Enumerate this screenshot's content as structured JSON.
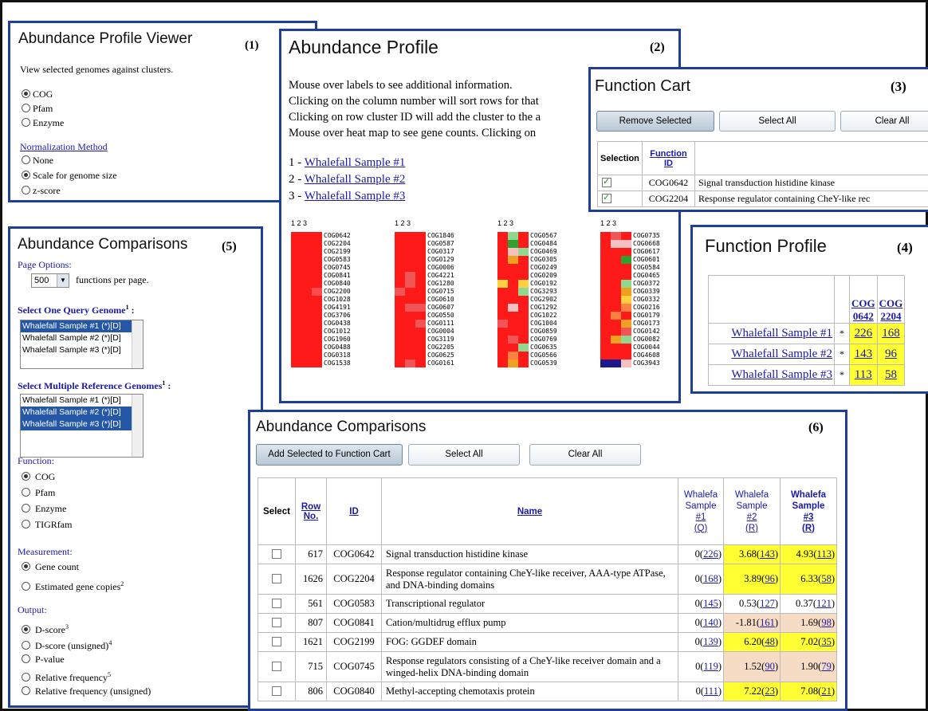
{
  "p1": {
    "title": "Abundance Profile Viewer",
    "num": "(1)",
    "desc": "View selected genomes against clusters.",
    "func_options": [
      {
        "label": "COG",
        "on": true
      },
      {
        "label": "Pfam",
        "on": false
      },
      {
        "label": "Enzyme",
        "on": false
      }
    ],
    "norm_label": "Normalization Method",
    "norm_options": [
      {
        "label": "None",
        "on": false
      },
      {
        "label": "Scale for genome size",
        "on": true
      },
      {
        "label": "z-score",
        "on": false
      }
    ]
  },
  "p2": {
    "title": "Abundance Profile",
    "num": "(2)",
    "lines": [
      "Mouse over labels to see additional information.",
      "Clicking on the column number will sort rows for that",
      "Clicking on row cluster ID will add the cluster to the a",
      "Mouse over heat map to see gene counts. Clicking on"
    ],
    "samples": [
      {
        "prefix": "1 - ",
        "name": "Whalefall Sample #1"
      },
      {
        "prefix": "2 - ",
        "name": "Whalefall Sample #2"
      },
      {
        "prefix": "3 - ",
        "name": "Whalefall Sample #3"
      }
    ],
    "heatmap_header": "1 2 3",
    "heatmap_cols": [
      {
        "ids": [
          "COG0642",
          "COG2204",
          "COG2199",
          "COG0583",
          "COG0745",
          "COG0841",
          "COG0840",
          "COG2200",
          "COG1028",
          "COG4191",
          "COG3706",
          "COG0438",
          "COG1012",
          "COG1960",
          "COG0488",
          "COG0318",
          "COG1538"
        ]
      },
      {
        "ids": [
          "COG1846",
          "COG0587",
          "COG0317",
          "COG0129",
          "COG0006",
          "COG4221",
          "COG1280",
          "COG0715",
          "COG0610",
          "COG0607",
          "COG0550",
          "COG0111",
          "COG0004",
          "COG3119",
          "COG2205",
          "COG0625",
          "COG0161"
        ]
      },
      {
        "ids": [
          "COG0567",
          "COG0484",
          "COG0469",
          "COG0305",
          "COG0249",
          "COG0209",
          "COG0192",
          "COG3293",
          "COG2902",
          "COG1292",
          "COG1022",
          "COG1004",
          "COG0859",
          "COG0769",
          "COG0635",
          "COG0566",
          "COG0539"
        ]
      },
      {
        "ids": [
          "COG0735",
          "COG0668",
          "COG0617",
          "COG0601",
          "COG0584",
          "COG0465",
          "COG0372",
          "COG0339",
          "COG0332",
          "COG0216",
          "COG0179",
          "COG0173",
          "COG0142",
          "COG0082",
          "COG0044",
          "COG4608",
          "COG3943"
        ]
      }
    ]
  },
  "p3": {
    "title": "Function Cart",
    "num": "(3)",
    "btn_remove": "Remove Selected",
    "btn_select_all": "Select All",
    "btn_clear_all": "Clear All",
    "col_selection": "Selection",
    "col_function_id": "Function ID",
    "rows": [
      {
        "id": "COG0642",
        "name": "Signal transduction histidine kinase"
      },
      {
        "id": "COG2204",
        "name": "Response regulator containing CheY-like rec"
      }
    ]
  },
  "p4": {
    "title": "Function Profile",
    "num": "(4)",
    "cols": [
      {
        "a": "COG",
        "b": "0642"
      },
      {
        "a": "COG",
        "b": "2204"
      }
    ],
    "rows": [
      {
        "name": "Whalefall Sample #1",
        "star": "*",
        "v1": "226",
        "v2": "168"
      },
      {
        "name": "Whalefall Sample #2",
        "star": "*",
        "v1": "143",
        "v2": "96"
      },
      {
        "name": "Whalefall Sample #3",
        "star": "*",
        "v1": "113",
        "v2": "58"
      }
    ]
  },
  "p5": {
    "title": "Abundance Comparisons",
    "num": "(5)",
    "page_options": "Page Options",
    "per_page_value": "500",
    "per_page_label": "functions per page.",
    "query_label": "Select One Query Genome",
    "query_sup": "1",
    "query_options": [
      {
        "label": "Whalefall Sample #1 (*)[D]",
        "sel": true
      },
      {
        "label": "Whalefall Sample #2 (*)[D]",
        "sel": false
      },
      {
        "label": "Whalefall Sample #3 (*)[D]",
        "sel": false
      }
    ],
    "ref_label": "Select Multiple Reference Genomes",
    "ref_sup": "1",
    "ref_options": [
      {
        "label": "Whalefall Sample #1 (*)[D]",
        "sel": false
      },
      {
        "label": "Whalefall Sample #2 (*)[D]",
        "sel": true
      },
      {
        "label": "Whalefall Sample #3 (*)[D]",
        "sel": true
      }
    ],
    "function_label": "Function",
    "function_options": [
      {
        "label": "COG",
        "on": true,
        "sup": ""
      },
      {
        "label": "Pfam",
        "on": false,
        "sup": ""
      },
      {
        "label": "Enzyme",
        "on": false,
        "sup": ""
      },
      {
        "label": "TIGRfam",
        "on": false,
        "sup": ""
      }
    ],
    "measurement_label": "Measurement",
    "measurement_options": [
      {
        "label": "Gene count",
        "on": true,
        "sup": ""
      },
      {
        "label": "Estimated gene copies",
        "on": false,
        "sup": "2"
      }
    ],
    "output_label": "Output",
    "output_options": [
      {
        "label": "D-score",
        "on": true,
        "sup": "3"
      },
      {
        "label": "D-score (unsigned)",
        "on": false,
        "sup": "4"
      },
      {
        "label": "P-value",
        "on": false,
        "sup": ""
      },
      {
        "label": "Relative frequency",
        "on": false,
        "sup": "5"
      },
      {
        "label": "Relative frequency (unsigned)",
        "on": false,
        "sup": ""
      }
    ]
  },
  "p6": {
    "title": "Abundance Comparisons",
    "num": "(6)",
    "btn_add": "Add Selected to Function Cart",
    "btn_select_all": "Select All",
    "btn_clear_all": "Clear All",
    "headers": {
      "select": "Select",
      "row_no_a": "Row",
      "row_no_b": "No.",
      "id": "ID",
      "name": "Name",
      "s1": [
        "Whalefa",
        "Sample",
        "#1",
        "(Q)"
      ],
      "s2": [
        "Whalefa",
        "Sample",
        "#2",
        "(R)"
      ],
      "s3": [
        "Whalefa",
        "Sample",
        "#3",
        "(R)"
      ]
    },
    "rows": [
      {
        "row": "617",
        "id": "COG0642",
        "name": "Signal transduction histidine kinase",
        "q": "0",
        "qn": "226",
        "r2": "3.68",
        "r2n": "143",
        "r3": "4.93",
        "r3n": "113",
        "c2": "#ffff33",
        "c3": "#ffff33"
      },
      {
        "row": "1626",
        "id": "COG2204",
        "name": "Response regulator containing CheY-like receiver, AAA-type ATPase, and DNA-binding domains",
        "q": "0",
        "qn": "168",
        "r2": "3.89",
        "r2n": "96",
        "r3": "6.33",
        "r3n": "58",
        "c2": "#ffff33",
        "c3": "#ffff33"
      },
      {
        "row": "561",
        "id": "COG0583",
        "name": "Transcriptional regulator",
        "q": "0",
        "qn": "145",
        "r2": "0.53",
        "r2n": "127",
        "r3": "0.37",
        "r3n": "121",
        "c2": "#ffffff",
        "c3": "#ffffff"
      },
      {
        "row": "807",
        "id": "COG0841",
        "name": "Cation/multidrug efflux pump",
        "q": "0",
        "qn": "140",
        "r2": "-1.81",
        "r2n": "161",
        "r3": "1.69",
        "r3n": "98",
        "c2": "#f6dcc4",
        "c3": "#f6dcc4"
      },
      {
        "row": "1621",
        "id": "COG2199",
        "name": "FOG: GGDEF domain",
        "q": "0",
        "qn": "139",
        "r2": "6.20",
        "r2n": "48",
        "r3": "7.02",
        "r3n": "35",
        "c2": "#ffff33",
        "c3": "#ffff33"
      },
      {
        "row": "715",
        "id": "COG0745",
        "name": "Response regulators consisting of a CheY-like receiver domain and a winged-helix DNA-binding domain",
        "q": "0",
        "qn": "119",
        "r2": "1.52",
        "r2n": "90",
        "r3": "1.90",
        "r3n": "79",
        "c2": "#f6dcc4",
        "c3": "#f6dcc4"
      },
      {
        "row": "806",
        "id": "COG0840",
        "name": "Methyl-accepting chemotaxis protein",
        "q": "0",
        "qn": "111",
        "r2": "7.22",
        "r2n": "23",
        "r3": "7.08",
        "r3n": "21",
        "c2": "#ffff33",
        "c3": "#ffff33"
      }
    ]
  }
}
